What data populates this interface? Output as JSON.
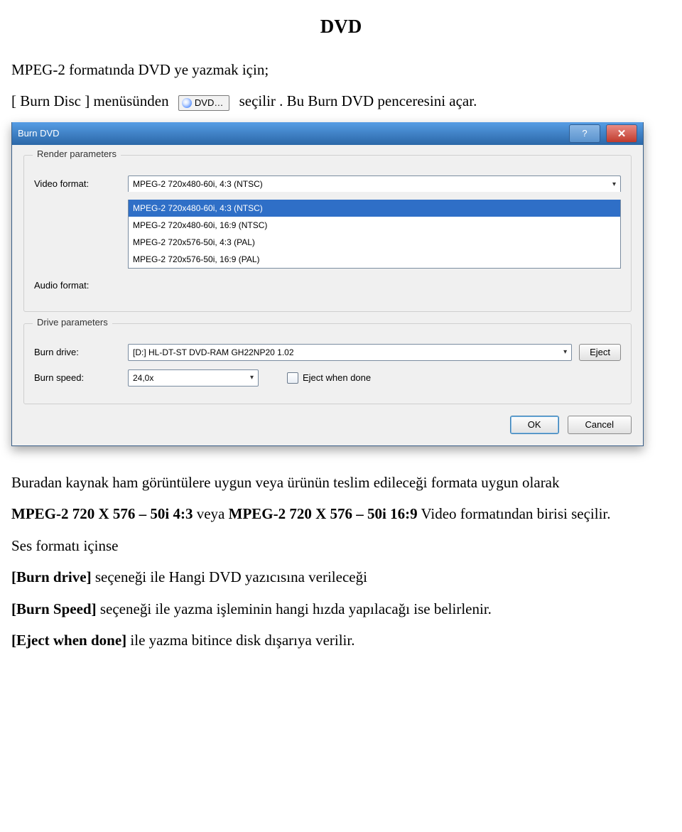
{
  "heading": "DVD",
  "intro_l1": "MPEG-2 formatında DVD ye yazmak için;",
  "intro_l2a": "[ Burn Disc ] menüsünden",
  "intro_l2b": "seçilir . Bu Burn DVD penceresini açar.",
  "menu_chip": "DVD…",
  "dialog": {
    "title": "Burn DVD",
    "help_glyph": "?",
    "close_glyph": "✕",
    "render_legend": "Render parameters",
    "video_label": "Video format:",
    "audio_label": "Audio format:",
    "video_selected": "MPEG-2 720x480-60i, 4:3 (NTSC)",
    "video_options": [
      "MPEG-2 720x480-60i, 4:3 (NTSC)",
      "MPEG-2 720x480-60i, 16:9 (NTSC)",
      "MPEG-2 720x576-50i, 4:3 (PAL)",
      "MPEG-2 720x576-50i, 16:9 (PAL)"
    ],
    "drive_legend": "Drive parameters",
    "drive_label": "Burn drive:",
    "drive_value": "[D:] HL-DT-ST DVD-RAM GH22NP20 1.02",
    "eject_btn": "Eject",
    "speed_label": "Burn speed:",
    "speed_value": "24,0x",
    "eject_done": "Eject when done",
    "ok": "OK",
    "cancel": "Cancel"
  },
  "body1": "Buradan kaynak ham görüntülere uygun veya ürünün teslim edileceği formata uygun olarak",
  "body2a": "MPEG-2 720 X 576 – 50i  4:3",
  "body2b": " veya ",
  "body2c": "MPEG-2 720 X 576 – 50i  16:9",
  "body2d": "  Video formatından birisi seçilir.",
  "body3": "Ses formatı içinse",
  "body4a": "[Burn drive]",
  "body4b": " seçeneği ile Hangi DVD yazıcısına verileceği",
  "body5a": "[Burn Speed]",
  "body5b": " seçeneği ile yazma işleminin hangi hızda yapılacağı  ise  belirlenir.",
  "body6a": "[Eject when done]",
  "body6b": " ile yazma bitince disk dışarıya verilir."
}
